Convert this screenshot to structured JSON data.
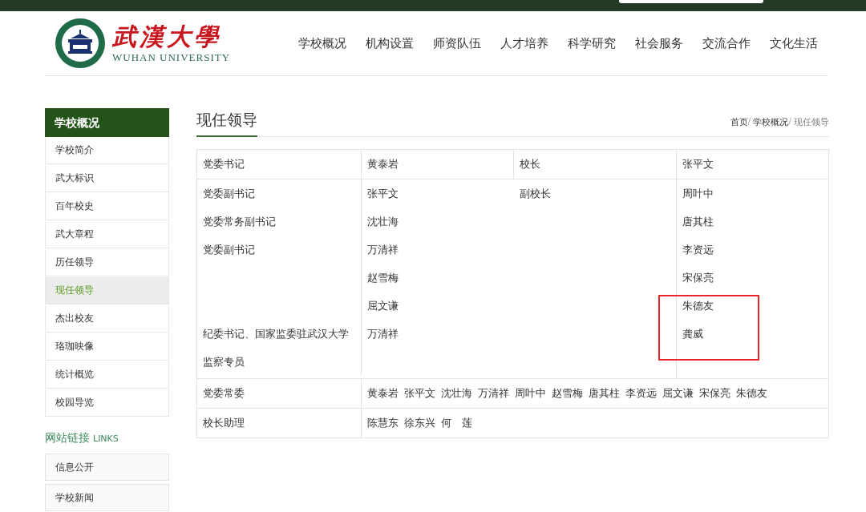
{
  "logo": {
    "name_cn": "武漢大學",
    "name_en": "WUHAN UNIVERSITY"
  },
  "nav": [
    "学校概况",
    "机构设置",
    "师资队伍",
    "人才培养",
    "科学研究",
    "社会服务",
    "交流合作",
    "文化生活"
  ],
  "sidebar": {
    "title": "学校概况",
    "items": [
      {
        "label": "学校简介",
        "selected": false
      },
      {
        "label": "武大标识",
        "selected": false
      },
      {
        "label": "百年校史",
        "selected": false
      },
      {
        "label": "武大章程",
        "selected": false
      },
      {
        "label": "历任领导",
        "selected": false
      },
      {
        "label": "现任领导",
        "selected": true
      },
      {
        "label": "杰出校友",
        "selected": false
      },
      {
        "label": "珞珈映像",
        "selected": false
      },
      {
        "label": "统计概览",
        "selected": false
      },
      {
        "label": "校园导览",
        "selected": false
      }
    ],
    "links_title": "网站链接",
    "links_subtitle": "LINKS",
    "links": [
      "信息公开",
      "学校新闻"
    ]
  },
  "page_title": "现任领导",
  "breadcrumb": [
    "首页",
    "学校概况",
    "现任领导"
  ],
  "breadcrumb_separator": "/",
  "table": {
    "secretary_title": "党委书记",
    "secretary": "黄泰岩",
    "president_title": "校长",
    "president": "张平文",
    "deputy_secretaries": [
      {
        "title": "党委副书记",
        "name": "张平文"
      },
      {
        "title": "党委常务副书记",
        "name": "沈壮海"
      },
      {
        "title": "党委副书记",
        "name": "万清祥"
      },
      {
        "name": "赵雪梅"
      },
      {
        "name": "屈文谦"
      },
      {
        "title": "纪委书记、国家监委驻武汉大学监察专员",
        "name": "万清祥"
      }
    ],
    "vice_president_title": "副校长",
    "vice_presidents": [
      {
        "name": "周叶中",
        "highlighted": false
      },
      {
        "name": "唐其柱",
        "highlighted": false
      },
      {
        "name": "李资远",
        "highlighted": false
      },
      {
        "name": "宋保亮",
        "highlighted": false
      },
      {
        "name": "朱德友",
        "highlighted": true
      },
      {
        "name": "龚威",
        "highlighted": true
      }
    ],
    "standing_title": "党委常委",
    "standing": [
      "黄泰岩",
      "张平文",
      "沈壮海",
      "万清祥",
      "周叶中",
      "赵雪梅",
      "唐其柱",
      "李资远",
      "屈文谦",
      "宋保亮",
      "朱德友"
    ],
    "assistants_title": "校长助理",
    "assistants": [
      "陈慧东",
      "徐东兴",
      "何　莲"
    ]
  }
}
